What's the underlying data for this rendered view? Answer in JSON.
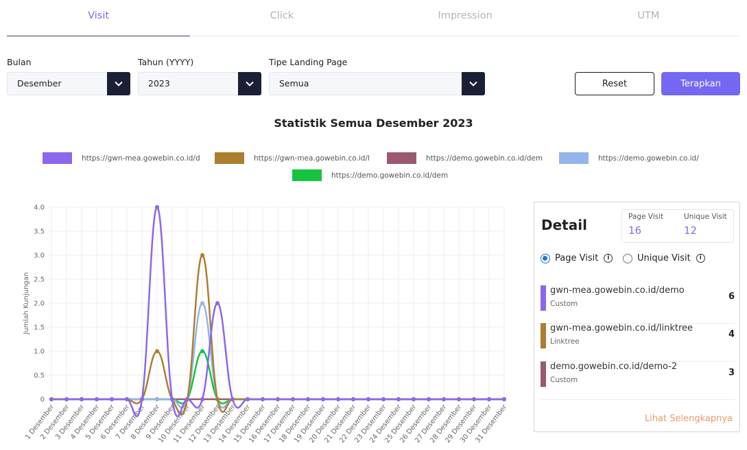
{
  "tabs": [
    {
      "label": "Visit",
      "active": true
    },
    {
      "label": "Click",
      "active": false
    },
    {
      "label": "Impression",
      "active": false
    },
    {
      "label": "UTM",
      "active": false
    }
  ],
  "filters": {
    "month": {
      "label": "Bulan",
      "value": "Desember"
    },
    "year": {
      "label": "Tahun (YYYY)",
      "value": "2023"
    },
    "landing_type": {
      "label": "Tipe Landing Page",
      "value": "Semua"
    },
    "reset_label": "Reset",
    "apply_label": "Terapkan"
  },
  "colors": {
    "accent": "#7468f2",
    "dark": "#1a2035",
    "link": "#e89a6c"
  },
  "chart_data": {
    "type": "line",
    "title": "Statistik Semua Desember 2023",
    "ylabel": "Jumlah Kunjungan",
    "xlabel": "",
    "ylim": [
      0,
      4
    ],
    "yticks": [
      "0",
      "0.5",
      "1.0",
      "1.5",
      "2.0",
      "2.5",
      "3.0",
      "3.5",
      "4.0"
    ],
    "grid": true,
    "legend_position": "top",
    "categories": [
      "1 Desember",
      "2 Desember",
      "3 Desember",
      "4 Desember",
      "5 Desember",
      "6 Desember",
      "7 Desember",
      "8 Desember",
      "9 Desember",
      "10 Desember",
      "11 Desember",
      "12 Desember",
      "13 Desember",
      "14 Desember",
      "15 Desember",
      "16 Desember",
      "17 Desember",
      "18 Desember",
      "19 Desember",
      "20 Desember",
      "21 Desember",
      "22 Desember",
      "23 Desember",
      "24 Desember",
      "25 Desember",
      "26 Desember",
      "27 Desember",
      "28 Desember",
      "29 Desember",
      "30 Desember",
      "31 Desember"
    ],
    "series": [
      {
        "name": "https://gwn-mea.gowebin.co.id/d",
        "color": "#8b67ea",
        "values": [
          0,
          0,
          0,
          0,
          0,
          0,
          0,
          4,
          0,
          0,
          0,
          2,
          0,
          0,
          0,
          0,
          0,
          0,
          0,
          0,
          0,
          0,
          0,
          0,
          0,
          0,
          0,
          0,
          0,
          0,
          0
        ]
      },
      {
        "name": "https://gwn-mea.gowebin.co.id/l",
        "color": "#ad7e2f",
        "values": [
          0,
          0,
          0,
          0,
          0,
          0,
          0,
          1,
          0,
          0,
          3,
          0,
          0,
          0,
          0,
          0,
          0,
          0,
          0,
          0,
          0,
          0,
          0,
          0,
          0,
          0,
          0,
          0,
          0,
          0,
          0
        ]
      },
      {
        "name": "https://demo.gowebin.co.id/dem",
        "color": "#9b596d",
        "values": [
          0,
          0,
          0,
          0,
          0,
          0,
          0,
          0,
          0,
          0,
          0,
          0,
          0,
          0,
          0,
          0,
          0,
          0,
          0,
          0,
          0,
          0,
          0,
          0,
          0,
          0,
          0,
          0,
          0,
          0,
          0
        ]
      },
      {
        "name": "https://demo.gowebin.co.id/",
        "color": "#93b5ea",
        "values": [
          0,
          0,
          0,
          0,
          0,
          0,
          0,
          0,
          0,
          0,
          2,
          0,
          0,
          0,
          0,
          0,
          0,
          0,
          0,
          0,
          0,
          0,
          0,
          0,
          0,
          0,
          0,
          0,
          0,
          0,
          0
        ]
      },
      {
        "name": "https://demo.gowebin.co.id/dem",
        "color": "#16c33f",
        "values": [
          0,
          0,
          0,
          0,
          0,
          0,
          0,
          0,
          0,
          0,
          1,
          0,
          0,
          0,
          0,
          0,
          0,
          0,
          0,
          0,
          0,
          0,
          0,
          0,
          0,
          0,
          0,
          0,
          0,
          0,
          0
        ]
      }
    ]
  },
  "detail": {
    "title": "Detail",
    "page_visit_label": "Page Visit",
    "page_visit_value": "16",
    "unique_visit_label": "Unique Visit",
    "unique_visit_value": "12",
    "radio_page_visit": "Page Visit",
    "radio_unique_visit": "Unique Visit",
    "info_glyph": "i",
    "items": [
      {
        "url": "gwn-mea.gowebin.co.id/demo",
        "type": "Custom",
        "count": "6",
        "color": "#8b67ea"
      },
      {
        "url": "gwn-mea.gowebin.co.id/linktree",
        "type": "Linktree",
        "count": "4",
        "color": "#ad7e2f"
      },
      {
        "url": "demo.gowebin.co.id/demo-2",
        "type": "Custom",
        "count": "3",
        "color": "#9b596d"
      }
    ],
    "see_more": "Lihat Selengkapnya"
  }
}
